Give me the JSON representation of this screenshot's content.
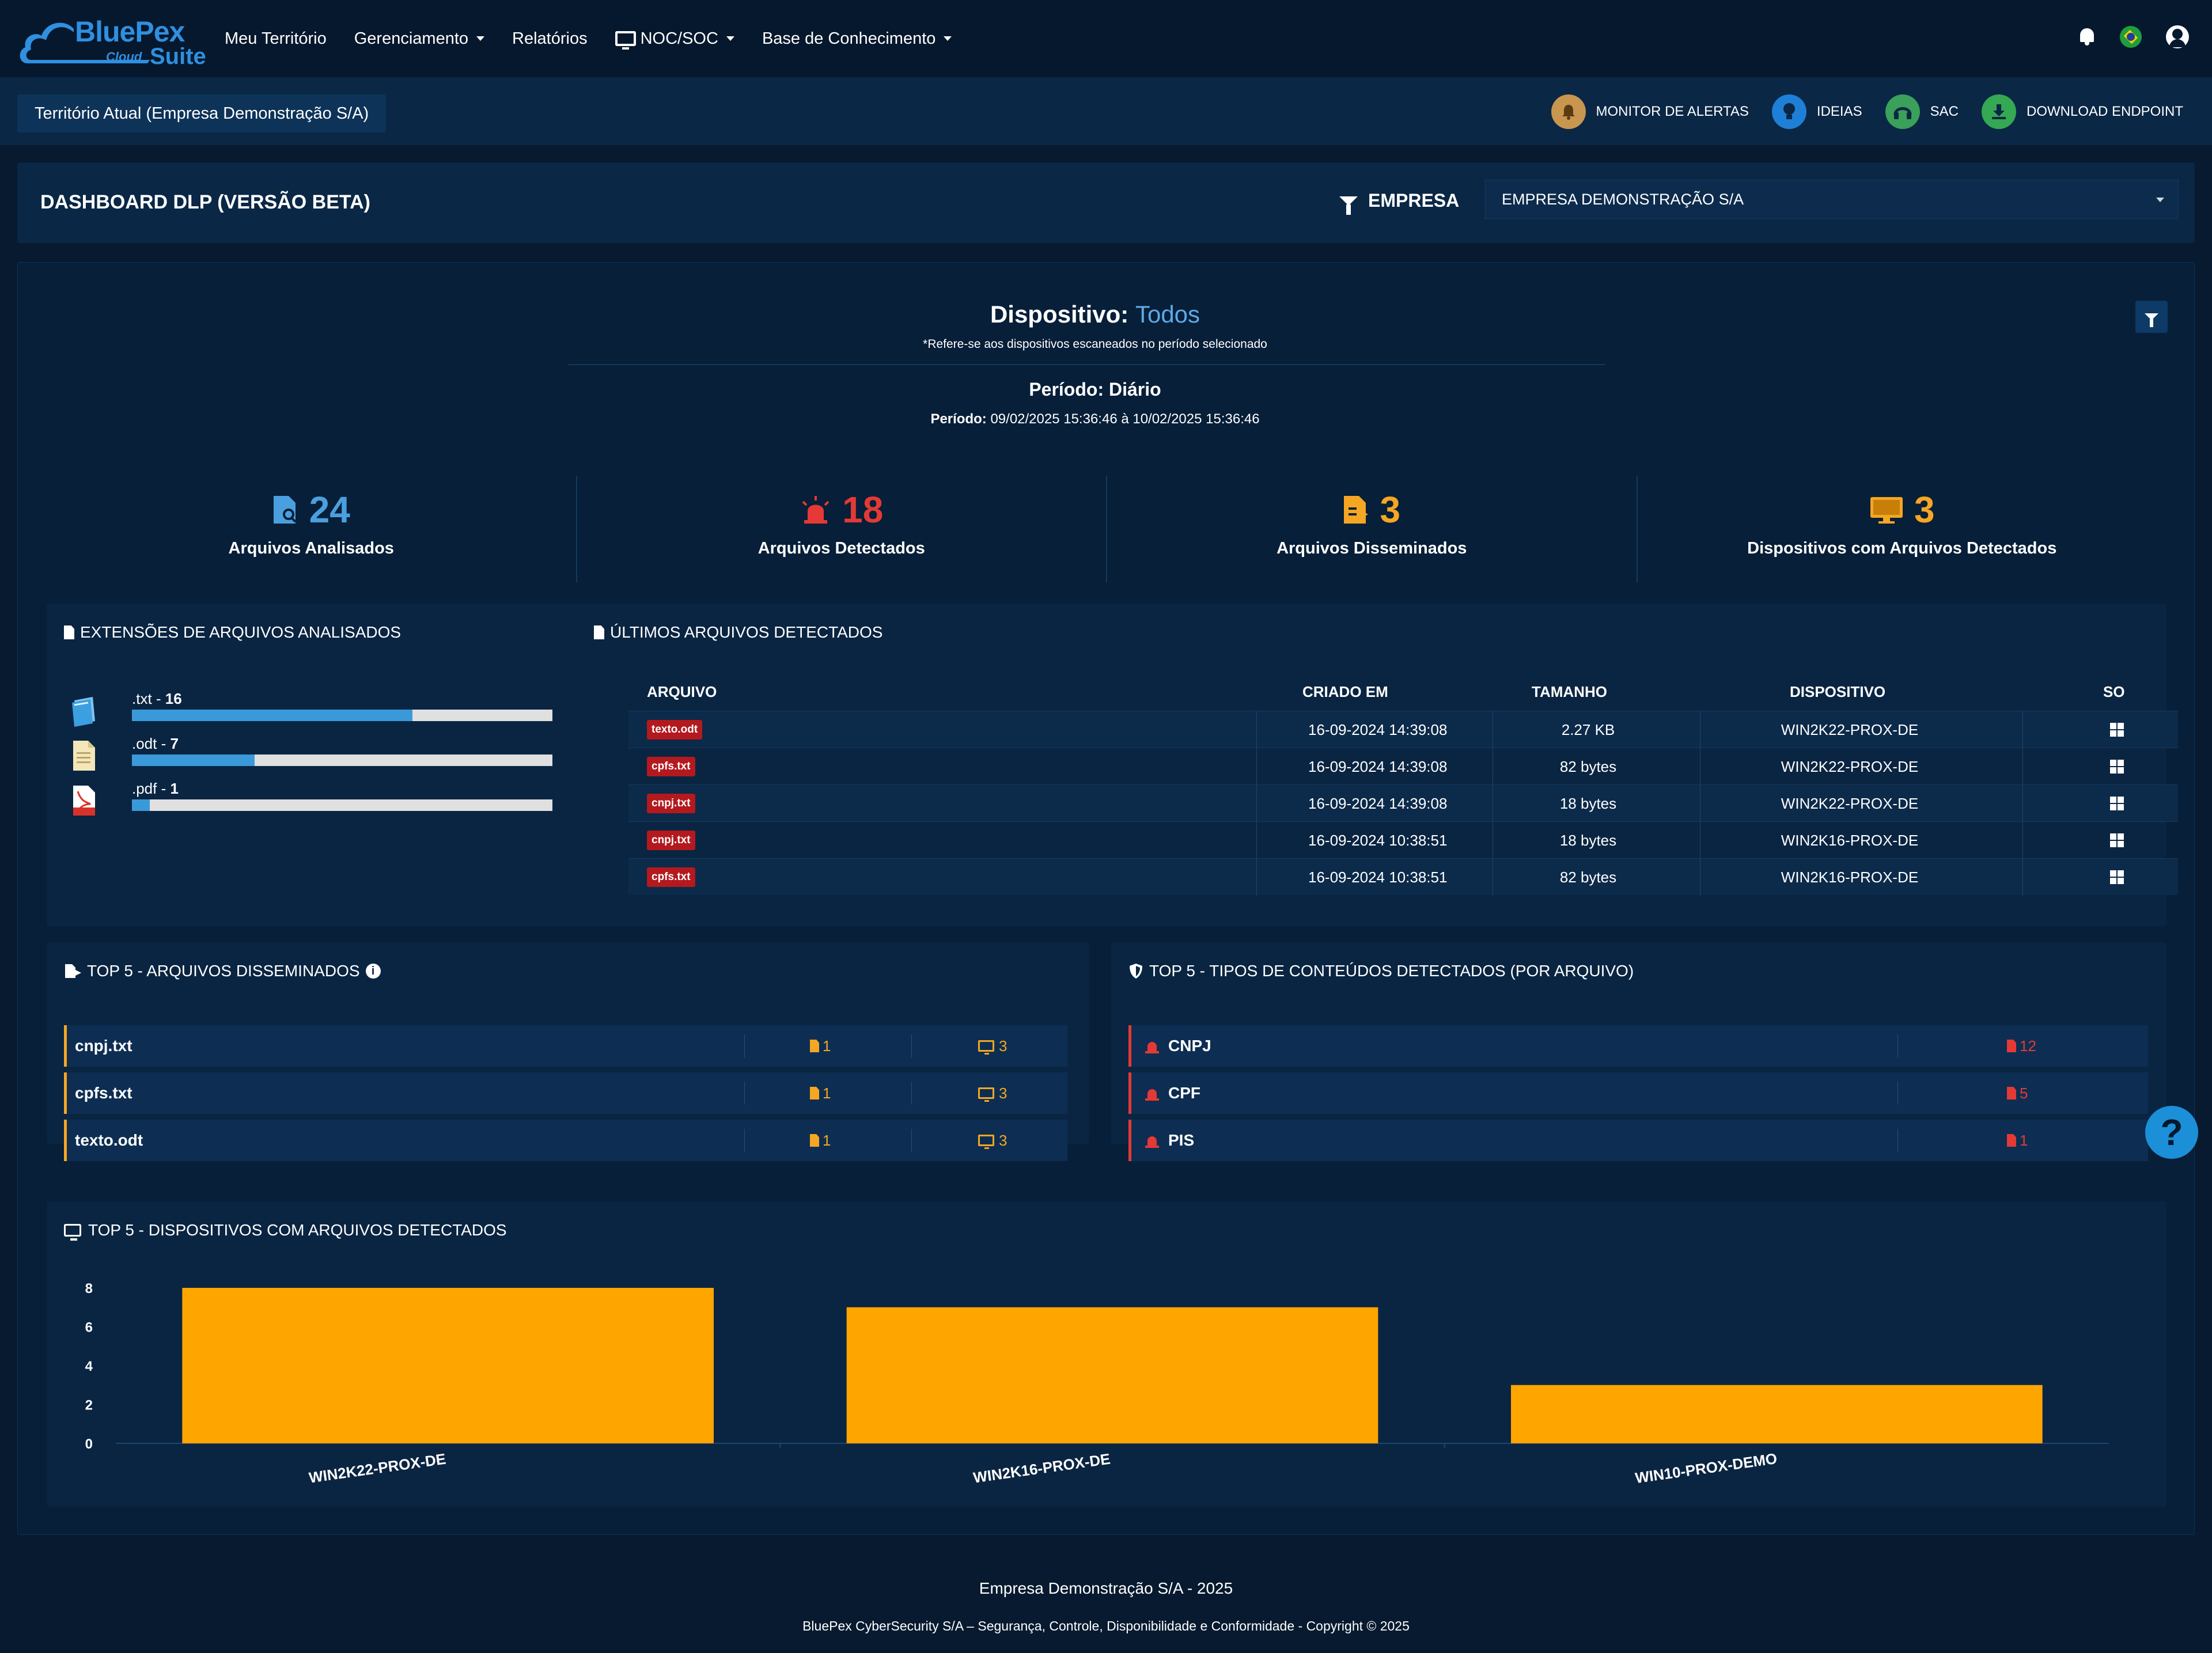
{
  "brand": {
    "name": "BluePex",
    "sub": "Cloud",
    "suite": "Suite"
  },
  "nav": {
    "items": [
      {
        "label": "Meu Território",
        "dropdown": false,
        "icon": null
      },
      {
        "label": "Gerenciamento",
        "dropdown": true,
        "icon": null
      },
      {
        "label": "Relatórios",
        "dropdown": false,
        "icon": null
      },
      {
        "label": "NOC/SOC",
        "dropdown": true,
        "icon": "monitor-icon"
      },
      {
        "label": "Base de Conhecimento",
        "dropdown": true,
        "icon": null
      }
    ]
  },
  "subbar": {
    "territory": "Território Atual (Empresa Demonstração S/A)",
    "quick": [
      {
        "label": "MONITOR DE ALERTAS",
        "icon": "bell-icon"
      },
      {
        "label": "IDEIAS",
        "icon": "lightbulb-icon"
      },
      {
        "label": "SAC",
        "icon": "headset-icon"
      },
      {
        "label": "DOWNLOAD ENDPOINT",
        "icon": "download-icon"
      }
    ]
  },
  "header": {
    "title": "DASHBOARD DLP (VERSÃO BETA)",
    "filter_label": "EMPRESA",
    "company_selected": "EMPRESA DEMONSTRAÇÃO S/A"
  },
  "device": {
    "label": "Dispositivo:",
    "value": "Todos",
    "note": "*Refere-se aos dispositivos escaneados no período selecionado"
  },
  "period": {
    "title": "Período: Diário",
    "range_label": "Período:",
    "range_value": "09/02/2025 15:36:46 à 10/02/2025 15:36:46"
  },
  "stats": [
    {
      "value": "24",
      "label": "Arquivos Analisados",
      "color": "#4a9fdf",
      "icon": "file-search-icon"
    },
    {
      "value": "18",
      "label": "Arquivos Detectados",
      "color": "#e53935",
      "icon": "siren-icon"
    },
    {
      "value": "3",
      "label": "Arquivos Disseminados",
      "color": "#f5a623",
      "icon": "file-share-icon"
    },
    {
      "value": "3",
      "label": "Dispositivos com Arquivos Detectados",
      "color": "#f5a623",
      "icon": "monitor-icon"
    }
  ],
  "extensions": {
    "title": "EXTENSÕES DE ARQUIVOS ANALISADOS",
    "items": [
      {
        "ext": ".txt -",
        "count": "16",
        "fraction": 0.667,
        "icon": "txt-file-icon"
      },
      {
        "ext": ".odt -",
        "count": "7",
        "fraction": 0.292,
        "icon": "odt-file-icon"
      },
      {
        "ext": ".pdf -",
        "count": "1",
        "fraction": 0.042,
        "icon": "pdf-file-icon"
      }
    ]
  },
  "recent": {
    "title": "ÚLTIMOS ARQUIVOS DETECTADOS",
    "columns": [
      "ARQUIVO",
      "CRIADO EM",
      "TAMANHO",
      "DISPOSITIVO",
      "SO"
    ],
    "rows": [
      {
        "file": "texto.odt",
        "created": "16-09-2024 14:39:08",
        "size": "2.27 KB",
        "device": "WIN2K22-PROX-DE"
      },
      {
        "file": "cpfs.txt",
        "created": "16-09-2024 14:39:08",
        "size": "82 bytes",
        "device": "WIN2K22-PROX-DE"
      },
      {
        "file": "cnpj.txt",
        "created": "16-09-2024 14:39:08",
        "size": "18 bytes",
        "device": "WIN2K22-PROX-DE"
      },
      {
        "file": "cnpj.txt",
        "created": "16-09-2024 10:38:51",
        "size": "18 bytes",
        "device": "WIN2K16-PROX-DE"
      },
      {
        "file": "cpfs.txt",
        "created": "16-09-2024 10:38:51",
        "size": "82 bytes",
        "device": "WIN2K16-PROX-DE"
      }
    ]
  },
  "top_disseminated": {
    "title": "TOP 5 - ARQUIVOS DISSEMINADOS",
    "rows": [
      {
        "name": "cnpj.txt",
        "files": "1",
        "devices": "3"
      },
      {
        "name": "cpfs.txt",
        "files": "1",
        "devices": "3"
      },
      {
        "name": "texto.odt",
        "files": "1",
        "devices": "3"
      }
    ]
  },
  "top_content": {
    "title": "TOP 5 - TIPOS DE CONTEÚDOS DETECTADOS (POR ARQUIVO)",
    "rows": [
      {
        "name": "CNPJ",
        "count": "12"
      },
      {
        "name": "CPF",
        "count": "5"
      },
      {
        "name": "PIS",
        "count": "1"
      }
    ]
  },
  "devices_chart": {
    "title": "TOP 5 - DISPOSITIVOS COM ARQUIVOS DETECTADOS"
  },
  "chart_data": {
    "type": "bar",
    "categories": [
      "WIN2K22-PROX-DE",
      "WIN2K16-PROX-DE",
      "WIN10-PROX-DEMO"
    ],
    "values": [
      8,
      7,
      3
    ],
    "yticks": [
      0,
      2,
      4,
      6,
      8
    ],
    "ylim": [
      0,
      8
    ],
    "color": "#ffa500",
    "title": "",
    "xlabel": "",
    "ylabel": ""
  },
  "footer": {
    "line1": "Empresa Demonstração S/A - 2025",
    "line2": "BluePex CyberSecurity S/A – Segurança, Controle, Disponibilidade e Conformidade - Copyright © 2025"
  }
}
